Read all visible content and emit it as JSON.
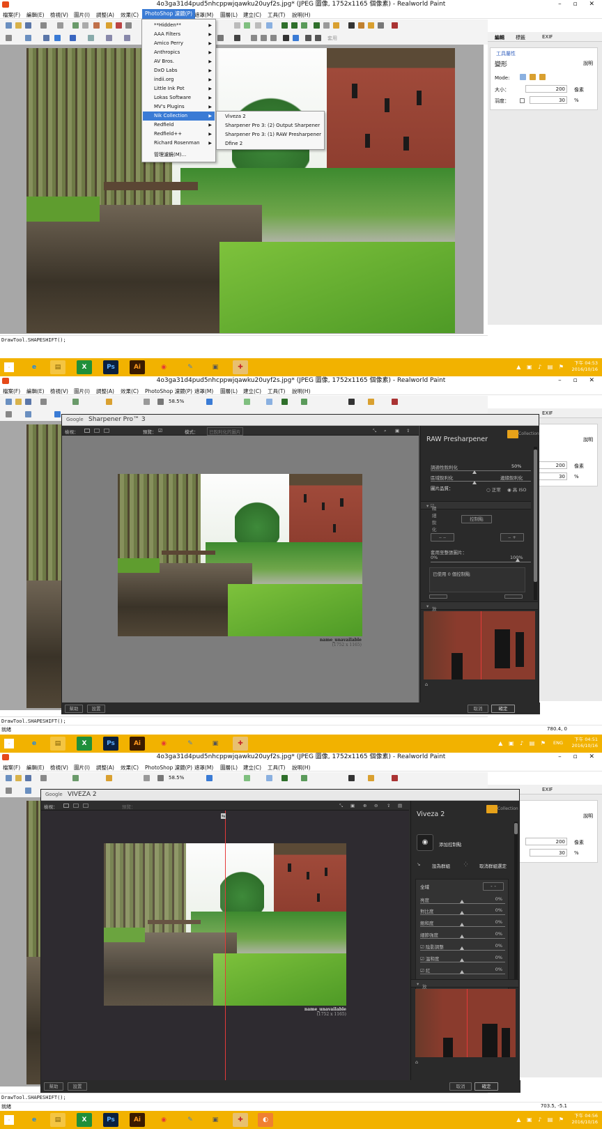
{
  "app": {
    "window_title": "4o3ga31d4pud5nhcppwjqawku20uyf2s.jpg* (JPEG 圖像, 1752x1165 個像素) - Realworld Paint",
    "window_controls": "– ▫ ✕"
  },
  "menubar": [
    "檔案(F)",
    "編輯(E)",
    "檢視(V)",
    "圖片(I)",
    "調整(A)",
    "效果(C)",
    "PhotoShop 濾鏡(P)",
    "遮罩(M)",
    "圖層(L)",
    "建立(C)",
    "工具(T)",
    "說明(H)"
  ],
  "toolbar": {
    "zoom": "58.5%",
    "apply": "套用"
  },
  "right_panel": {
    "tabs": [
      "編輯",
      "標籤",
      "EXIF"
    ],
    "section_header": "工具屬性",
    "tool_name": "變形",
    "help": "說明",
    "mode_label": "Mode:",
    "size_label": "大小：",
    "size_value": "200",
    "size_unit": "像素",
    "blur_label": "羽度：",
    "blur_value": "30",
    "blur_unit": "%"
  },
  "plugin_menu": {
    "items": [
      {
        "label": "**Hidden**",
        "submenu": true
      },
      {
        "label": "AAA Filters",
        "submenu": true
      },
      {
        "label": "Amico Perry",
        "submenu": true
      },
      {
        "label": "Anthropics",
        "submenu": true
      },
      {
        "label": "AV Bros.",
        "submenu": true
      },
      {
        "label": "DxO Labs",
        "submenu": true
      },
      {
        "label": "indii.org",
        "submenu": true
      },
      {
        "label": "Little Ink Pot",
        "submenu": true
      },
      {
        "label": "Lokas Software",
        "submenu": true
      },
      {
        "label": "MV's Plugins",
        "submenu": true
      },
      {
        "label": "Nik Collection",
        "submenu": true,
        "highlighted": true
      },
      {
        "label": "Redfield",
        "submenu": true
      },
      {
        "label": "Redfield++",
        "submenu": true
      },
      {
        "label": "Richard Rosenman",
        "submenu": true
      },
      {
        "label": "管理濾鏡(M)...",
        "submenu": false
      }
    ],
    "submenu_items": [
      "Viveza 2",
      "Sharpener Pro 3: (2) Output Sharpener",
      "Sharpener Pro 3: (1) RAW Presharpener",
      "Dfine 2"
    ]
  },
  "status": {
    "script": "DrawTool.SHAPESHIFT();",
    "ready": "就緒",
    "coords_2": "780.4, 0",
    "coords_3": "703.5, -5.1"
  },
  "taskbar": {
    "apps": [
      "e",
      "▤",
      "X",
      "Ps",
      "Ai",
      "◉",
      "✎",
      "▣",
      "✚",
      "◐"
    ],
    "tray": [
      {
        "time": "下午 04:53",
        "date": "2016/10/16"
      },
      {
        "time": "下午 04:51",
        "date": "2016/10/16",
        "lang": "ENG"
      },
      {
        "time": "下午 04:56",
        "date": "2016/10/16"
      }
    ]
  },
  "sharpener": {
    "google": "Google",
    "title": "Sharpener Pro™ 3",
    "view_label": "檢視：",
    "preview_label": "預覽：",
    "mode_label": "模式：",
    "mode_value": "已銳利化的圖片",
    "panel_title": "RAW Presharpener",
    "collection": "Collection",
    "adaptive": "調適性銳利化",
    "adaptive_value": "50%",
    "area_sharp": "區域銳利化",
    "edge_sharp": "邊緣銳利化",
    "image_quality": "圖片品質：",
    "normal": "正常",
    "high_iso": "高 ISO",
    "selective": "精細銳化",
    "control_points": "控制點",
    "apply_to_whole": "套用至整張圖片：",
    "pct_0": "0%",
    "pct_100": "100%",
    "used_points": "已使用 0 個控制點",
    "loupe_label": "放大鏡",
    "watermark": "name_unavailable",
    "dims": "(1752 x 1165)",
    "help": "幫助",
    "settings": "設置",
    "cancel": "取消",
    "ok": "確定"
  },
  "viveza": {
    "google": "Google",
    "title": "VIVEZA 2",
    "view_label": "檢視：",
    "preview_label": "預覽：",
    "panel_title": "Viveza 2",
    "collection": "Collection",
    "add_cp": "添加控制點",
    "group": "設為群組",
    "ungroup": "取消群組選定",
    "global": "全域",
    "rows": [
      {
        "label": "亮度",
        "value": "0%"
      },
      {
        "label": "對比度",
        "value": "0%"
      },
      {
        "label": "飽和度",
        "value": "0%"
      },
      {
        "label": "細節強度",
        "value": "0%"
      },
      {
        "label": "陰影調整",
        "value": "0%"
      },
      {
        "label": "溫和度",
        "value": "0%"
      },
      {
        "label": "紅",
        "value": "0%"
      }
    ],
    "loupe_label": "放大鏡",
    "watermark": "name_unavailable",
    "dims": "(1752 x 1165)",
    "help": "幫助",
    "settings": "設置",
    "cancel": "取消",
    "ok": "確定"
  }
}
